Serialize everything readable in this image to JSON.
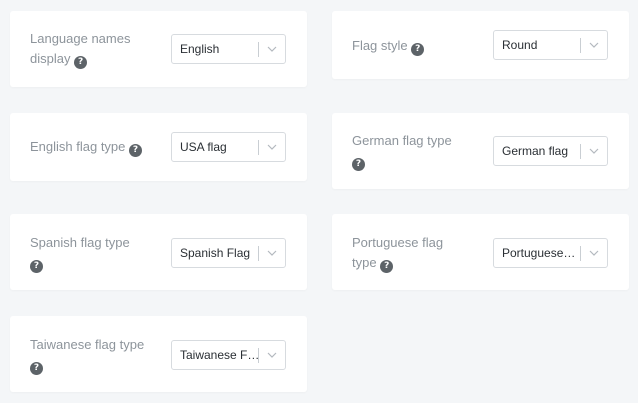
{
  "help_icon": {
    "glyph": "?"
  },
  "settings": {
    "language_names_display": {
      "label_line1": "Language names",
      "label_line2": "display",
      "value": "English"
    },
    "flag_style": {
      "label": "Flag style",
      "value": "Round"
    },
    "english_flag_type": {
      "label": "English flag type",
      "value": "USA flag"
    },
    "german_flag_type": {
      "label": "German flag type",
      "value": "German flag"
    },
    "spanish_flag_type": {
      "label": "Spanish flag type",
      "value": "Spanish Flag"
    },
    "portuguese_flag_type": {
      "label_line1": "Portuguese flag",
      "label_line2": "type",
      "value": "Portuguese Flag"
    },
    "taiwanese_flag_type": {
      "label": "Taiwanese flag type",
      "value": "Taiwanese Flag"
    }
  },
  "colors": {
    "page_background": "#f4f6f8",
    "card_background": "#ffffff",
    "label_text": "#8d949b",
    "value_text": "#2a2f34",
    "help_icon": "#5d6368"
  }
}
